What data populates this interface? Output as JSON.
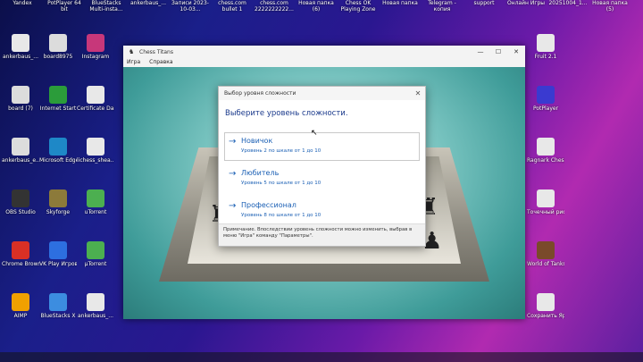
{
  "desktop": {
    "top_labels": [
      "Yandex",
      "PotPlayer 64 bit",
      "BlueStacks Multi-insta...",
      "ankerbaus_...",
      "Записи 2023- 10-03...",
      "chess.com bullet 1",
      "chess.com 2222222222...",
      "Новая папка (6)",
      "Chess OK Playing Zone",
      "Новая папка",
      "Telegram - копия",
      "support",
      "Онлайн Игры",
      "20251004_1...",
      "Новая папка (5)"
    ],
    "left_icons": [
      {
        "label": "ankerbaus_...",
        "color": "#e8e8e8"
      },
      {
        "label": "board8975",
        "color": "#dcdcdc"
      },
      {
        "label": "Instagram",
        "color": "#c7377a"
      },
      {
        "label": "board (7)",
        "color": "#dcdcdc"
      },
      {
        "label": "Internet Start",
        "color": "#2b9c3a"
      },
      {
        "label": "Certificate Daily Ch...",
        "color": "#e8e8e8"
      },
      {
        "label": "ankerbaus_e...",
        "color": "#dcdcdc"
      },
      {
        "label": "Microsoft Edge – ...",
        "color": "#1e88c7"
      },
      {
        "label": "lichess_shea...",
        "color": "#e8e8e8"
      },
      {
        "label": "OBS Studio",
        "color": "#333"
      },
      {
        "label": "Skyforge",
        "color": "#8c7a3a"
      },
      {
        "label": "uTorrent",
        "color": "#4caf50"
      },
      {
        "label": "Chrome Browser",
        "color": "#d93025"
      },
      {
        "label": "VK Play Игровой...",
        "color": "#2d6fe0"
      },
      {
        "label": "µTorrent",
        "color": "#4caf50"
      },
      {
        "label": "AIMP",
        "color": "#f0a000"
      },
      {
        "label": "BlueStacks X",
        "color": "#3c8de0"
      },
      {
        "label": "ankerbaus_...",
        "color": "#e8e8e8"
      }
    ],
    "right_icons": [
      {
        "label": "Fruit 2.1",
        "color": "#e8e8e8"
      },
      {
        "label": "PotPlayer",
        "color": "#3a3ad0"
      },
      {
        "label": "Ragnark Chess",
        "color": "#e8e8e8"
      },
      {
        "label": "Точечный рисунок",
        "color": "#e8e8e8"
      },
      {
        "label": "World of Tanks RU",
        "color": "#7a4a2a"
      },
      {
        "label": "Сохранить Ярлык",
        "color": "#e8e8e8"
      }
    ]
  },
  "window": {
    "title": "Chess Titans",
    "menu": [
      "Игра",
      "Справка"
    ],
    "controls": {
      "minimize": "—",
      "maximize": "☐",
      "close": "✕"
    }
  },
  "dialog": {
    "title": "Выбор уровня сложности",
    "heading": "Выберите уровень сложности.",
    "options": [
      {
        "name": "Новичок",
        "desc": "Уровень 2 по шкале от 1 до 10",
        "selected": true
      },
      {
        "name": "Любитель",
        "desc": "Уровень 5 по шкале от 1 до 10",
        "selected": false
      },
      {
        "name": "Профессионал",
        "desc": "Уровень 8 по шкале от 1 до 10",
        "selected": false
      }
    ],
    "note": "Примечание. Впоследствии уровень сложности можно изменить, выбрав в меню \"Игра\" команду \"Параметры\"."
  },
  "colors": {
    "accent": "#1a5fb4",
    "heading": "#1b3a8c"
  }
}
